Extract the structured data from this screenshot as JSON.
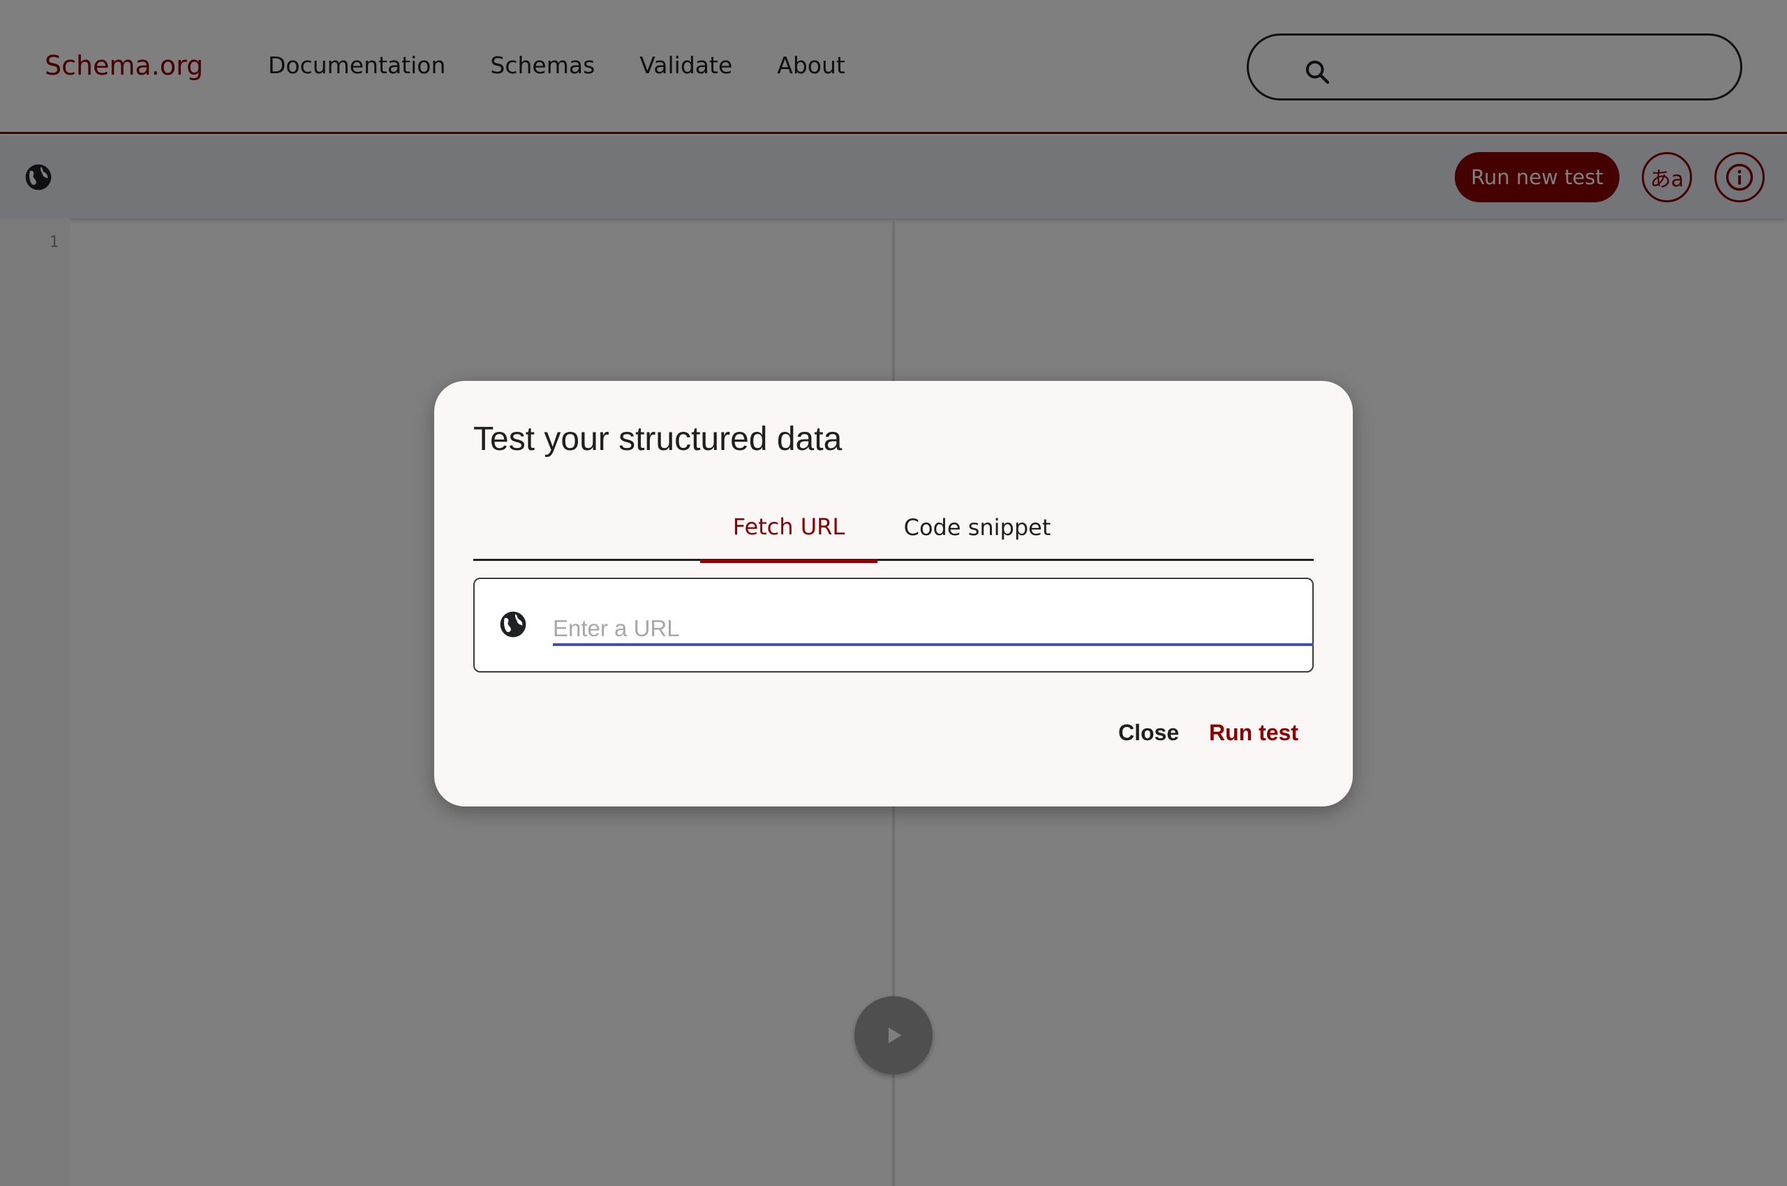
{
  "header": {
    "logo": "Schema.org",
    "nav": [
      "Documentation",
      "Schemas",
      "Validate",
      "About"
    ],
    "search_icon": "search-icon"
  },
  "toolbar": {
    "globe_icon": "globe-icon",
    "run_new_test_label": "Run new test",
    "language_button_label": "あa",
    "info_icon": "info-icon"
  },
  "editor": {
    "line_numbers": [
      "1"
    ],
    "run_icon": "play-icon"
  },
  "dialog": {
    "title": "Test your structured data",
    "tabs": [
      {
        "label": "Fetch URL",
        "active": true
      },
      {
        "label": "Code snippet",
        "active": false
      }
    ],
    "url_input": {
      "placeholder": "Enter a URL",
      "value": ""
    },
    "close_label": "Close",
    "run_test_label": "Run test"
  },
  "colors": {
    "accent": "#8b0000",
    "input_underline": "#3f51b5",
    "overlay": "rgba(0,0,0,0.5)"
  }
}
